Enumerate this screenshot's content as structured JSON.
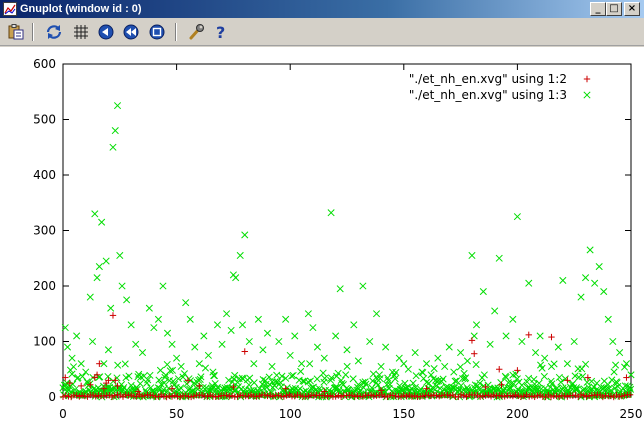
{
  "window": {
    "title": "Gnuplot (window id : 0)",
    "controls": {
      "minimize": "_",
      "maximize": "□",
      "close": "×"
    }
  },
  "toolbar": {
    "tools": [
      {
        "name": "copy-to-clipboard",
        "icon": "clipboard-icon"
      },
      {
        "name": "replot",
        "icon": "replot-icon"
      },
      {
        "name": "toggle-grid",
        "icon": "grid-icon"
      },
      {
        "name": "previous-zoom",
        "icon": "zoom-previous-icon"
      },
      {
        "name": "next-zoom",
        "icon": "zoom-next-icon"
      },
      {
        "name": "autoscale",
        "icon": "zoom-autoscale-icon"
      },
      {
        "name": "options",
        "icon": "wrench-icon"
      },
      {
        "name": "help",
        "icon": "help-icon"
      }
    ]
  },
  "chart_data": {
    "type": "scatter",
    "title": "",
    "xlabel": "",
    "ylabel": "",
    "xlim": [
      0,
      250
    ],
    "ylim": [
      0,
      600
    ],
    "xticks": [
      0,
      50,
      100,
      150,
      200,
      250
    ],
    "yticks": [
      0,
      100,
      200,
      300,
      400,
      500,
      600
    ],
    "grid": false,
    "legend": "top-right",
    "series": [
      {
        "name": "\"./et_nh_en.xvg\" using 1:2",
        "marker": "+",
        "color": "#cc0000",
        "x": [
          1,
          3,
          8,
          12,
          14,
          15,
          16,
          18,
          19,
          20,
          22,
          23,
          24,
          33,
          48,
          55,
          60,
          75,
          80,
          98,
          115,
          140,
          160,
          180,
          181,
          186,
          192,
          193,
          200,
          205,
          215,
          222,
          231,
          248
        ],
        "y": [
          35,
          25,
          20,
          22,
          35,
          40,
          60,
          15,
          25,
          30,
          147,
          30,
          20,
          10,
          15,
          30,
          20,
          18,
          82,
          15,
          10,
          12,
          15,
          102,
          78,
          18,
          50,
          22,
          48,
          112,
          108,
          30,
          35,
          35
        ]
      },
      {
        "name": "\"./et_nh_en.xvg\" using 1:3",
        "marker": "x",
        "color": "#00dd00",
        "x": [
          1,
          2,
          4,
          6,
          8,
          10,
          12,
          13,
          14,
          15,
          16,
          17,
          18,
          19,
          20,
          21,
          22,
          23,
          24,
          25,
          26,
          28,
          30,
          32,
          35,
          38,
          40,
          42,
          44,
          46,
          48,
          50,
          52,
          54,
          56,
          58,
          60,
          62,
          64,
          66,
          68,
          70,
          72,
          74,
          75,
          76,
          78,
          79,
          80,
          82,
          84,
          86,
          88,
          90,
          92,
          95,
          98,
          100,
          102,
          105,
          108,
          110,
          112,
          115,
          118,
          120,
          122,
          125,
          128,
          130,
          132,
          135,
          138,
          140,
          142,
          145,
          148,
          150,
          152,
          155,
          158,
          160,
          162,
          165,
          168,
          170,
          172,
          175,
          178,
          180,
          181,
          182,
          185,
          188,
          190,
          192,
          195,
          198,
          200,
          202,
          205,
          208,
          210,
          212,
          215,
          218,
          220,
          222,
          225,
          228,
          230,
          232,
          234,
          236,
          238,
          240,
          242,
          245,
          248,
          250
        ],
        "y": [
          125,
          90,
          70,
          110,
          60,
          45,
          180,
          100,
          330,
          215,
          235,
          315,
          60,
          245,
          85,
          160,
          450,
          480,
          525,
          255,
          200,
          175,
          130,
          95,
          80,
          160,
          125,
          140,
          200,
          115,
          95,
          70,
          55,
          170,
          140,
          90,
          60,
          110,
          75,
          45,
          130,
          95,
          150,
          120,
          220,
          215,
          255,
          130,
          292,
          100,
          60,
          140,
          85,
          115,
          55,
          100,
          140,
          75,
          110,
          60,
          150,
          125,
          90,
          70,
          332,
          110,
          195,
          85,
          130,
          65,
          200,
          100,
          150,
          55,
          90,
          45,
          70,
          60,
          50,
          80,
          45,
          60,
          40,
          70,
          55,
          90,
          45,
          80,
          65,
          255,
          110,
          130,
          190,
          95,
          155,
          250,
          110,
          140,
          325,
          100,
          205,
          80,
          110,
          70,
          55,
          90,
          210,
          60,
          100,
          180,
          215,
          265,
          205,
          235,
          190,
          140,
          100,
          80,
          60,
          40
        ]
      }
    ]
  }
}
